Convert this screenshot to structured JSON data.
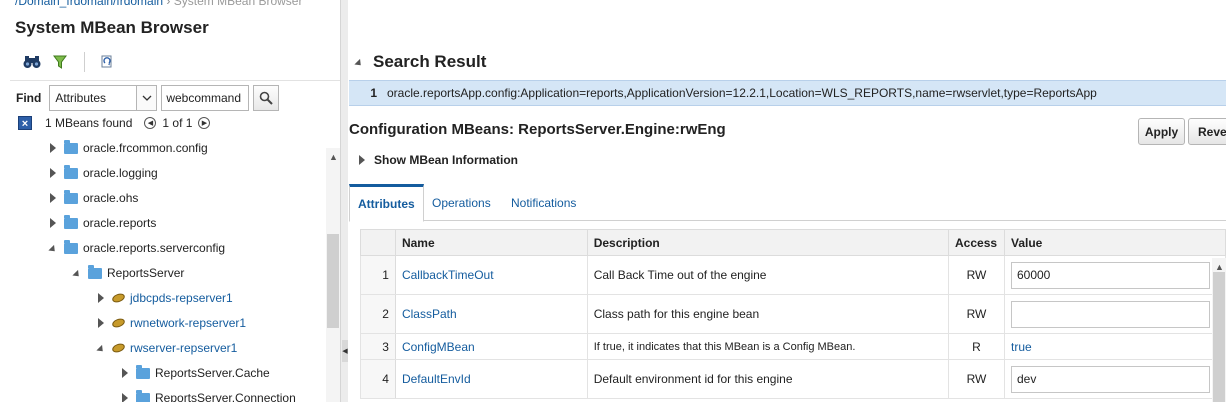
{
  "breadcrumb": {
    "domain": "/Domain_frdomain/frdomain",
    "separator": "›",
    "current": "System MBean Browser"
  },
  "left_panel": {
    "title": "System MBean Browser",
    "toolbar": {
      "icons": [
        "binoculars-icon",
        "filter-icon",
        "refresh-tree-icon"
      ]
    },
    "find": {
      "label": "Find",
      "scope_selected": "Attributes",
      "query_value": "webcommand"
    },
    "results": {
      "count_text": "1 MBeans found",
      "page_text": "1 of 1"
    },
    "tree": [
      {
        "label": "oracle.frcommon.config",
        "type": "folder",
        "expanded": false,
        "link": false
      },
      {
        "label": "oracle.logging",
        "type": "folder",
        "expanded": false,
        "link": false
      },
      {
        "label": "oracle.ohs",
        "type": "folder",
        "expanded": false,
        "link": false
      },
      {
        "label": "oracle.reports",
        "type": "folder",
        "expanded": false,
        "link": false
      },
      {
        "label": "oracle.reports.serverconfig",
        "type": "folder",
        "expanded": true,
        "link": false
      },
      {
        "label": "ReportsServer",
        "type": "folder",
        "expanded": true,
        "link": false
      },
      {
        "label": "jdbcpds-repserver1",
        "type": "bean",
        "expanded": false,
        "link": true
      },
      {
        "label": "rwnetwork-repserver1",
        "type": "bean",
        "expanded": false,
        "link": true
      },
      {
        "label": "rwserver-repserver1",
        "type": "bean",
        "expanded": true,
        "link": true
      },
      {
        "label": "ReportsServer.Cache",
        "type": "folder",
        "expanded": false,
        "link": false
      },
      {
        "label": "ReportsServer.Connection",
        "type": "folder",
        "expanded": false,
        "link": false
      }
    ]
  },
  "search_result": {
    "title": "Search Result",
    "rows": [
      {
        "num": "1",
        "name": "oracle.reportsApp.config:Application=reports,ApplicationVersion=12.2.1,Location=WLS_REPORTS,name=rwservlet,type=ReportsApp"
      }
    ]
  },
  "config": {
    "title": "Configuration MBeans: ReportsServer.Engine:rwEng",
    "apply_label": "Apply",
    "revert_label": "Reve",
    "show_info_label": "Show MBean Information",
    "tabs": [
      {
        "label": "Attributes",
        "active": true
      },
      {
        "label": "Operations",
        "active": false
      },
      {
        "label": "Notifications",
        "active": false
      }
    ],
    "columns": {
      "name": "Name",
      "description": "Description",
      "access": "Access",
      "value": "Value"
    },
    "rows": [
      {
        "num": "1",
        "name": "CallbackTimeOut",
        "description": "Call Back Time out of the engine",
        "access": "RW",
        "value": "60000",
        "editable": true
      },
      {
        "num": "2",
        "name": "ClassPath",
        "description": "Class path for this engine bean",
        "access": "RW",
        "value": "",
        "editable": true
      },
      {
        "num": "3",
        "name": "ConfigMBean",
        "description": "If true, it indicates that this MBean is a Config MBean.",
        "access": "R",
        "value": "true",
        "editable": false
      },
      {
        "num": "4",
        "name": "DefaultEnvId",
        "description": "Default environment id for this engine",
        "access": "RW",
        "value": "dev",
        "editable": true
      }
    ]
  },
  "colors": {
    "link": "#145c9e",
    "selection": "#d5e6f6",
    "folder": "#5aa2dc"
  }
}
